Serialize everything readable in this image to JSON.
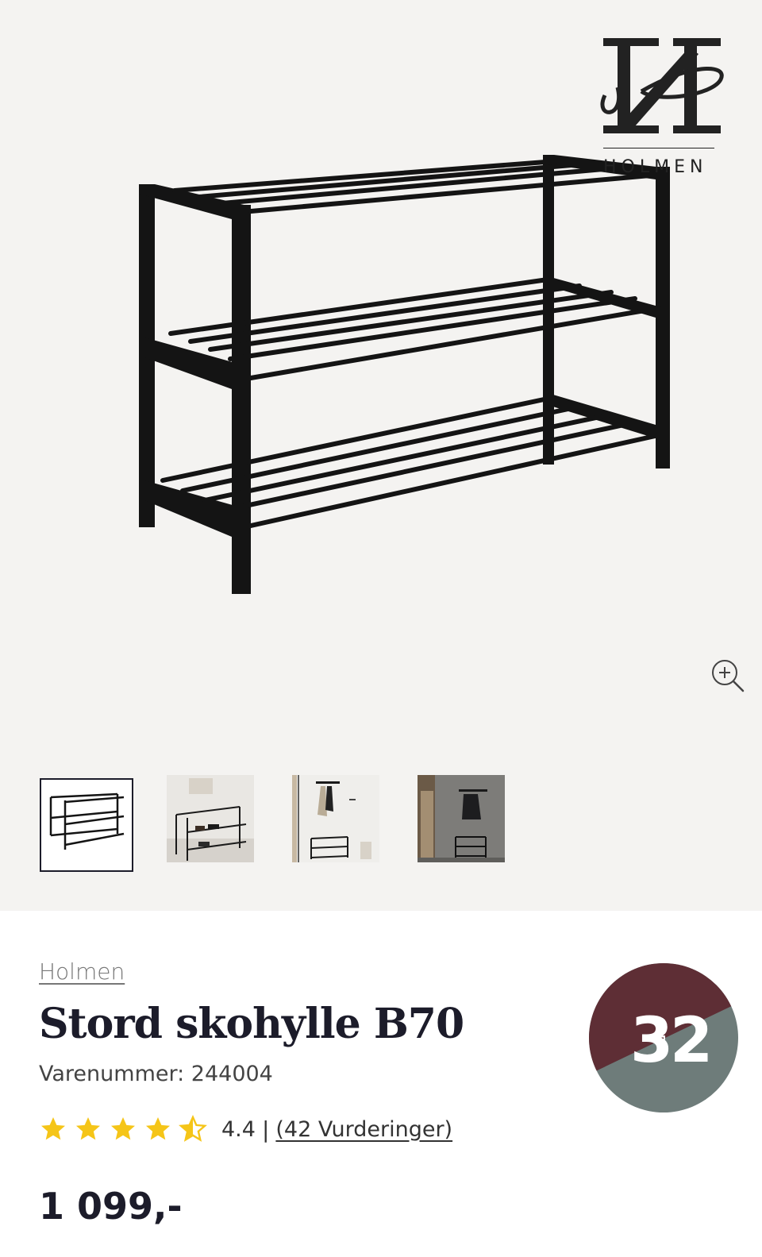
{
  "gallery": {
    "logo_text": "HOLMEN",
    "thumbnails": [
      {
        "name": "thumb-product-studio",
        "active": true
      },
      {
        "name": "thumb-hallway-shoes",
        "active": false
      },
      {
        "name": "thumb-wall-coat-rack",
        "active": false
      },
      {
        "name": "thumb-concrete-wall",
        "active": false
      }
    ]
  },
  "product": {
    "brand": "Holmen",
    "title": "Stord skohylle B70",
    "sku_label": "Varenummer: 244004",
    "rating_value": "4.4",
    "rating_fraction": 0.88,
    "rating_separator": "|",
    "reviews_label": "(42 Vurderinger)",
    "price": "1 099,-"
  },
  "badge": {
    "left_number": "3",
    "right_number": "2",
    "middle_text": "FOR",
    "colors": {
      "top": "#5e2e35",
      "bottom": "#6e7c7a",
      "text": "#ffffff"
    }
  },
  "colors": {
    "star": "#f5c518",
    "text": "#1c1c2a",
    "gallery_bg": "#f4f3f1"
  }
}
